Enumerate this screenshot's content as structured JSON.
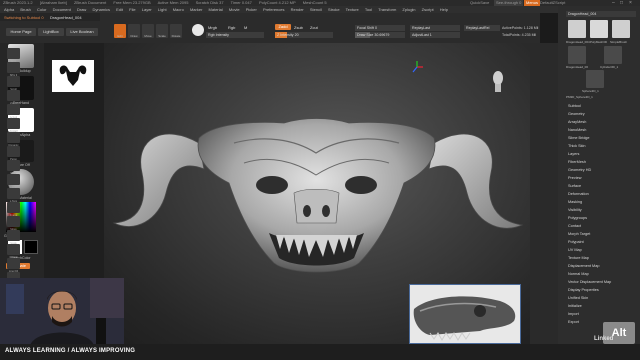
{
  "titlebar": {
    "app": "ZBrush 2023.1.2",
    "license": "[Abraham Ikeb]",
    "document": "ZBrush Document",
    "free_mem": "Free Mem 23.279GB",
    "active_mem": "Active Mem 2095",
    "scratch_disk": "Scratch Disk 37",
    "timer": "Timer 0.047",
    "polycount": "PolyCount 4.212 MP",
    "meshcount": "MeshCount 5",
    "quicksave": "QuickSave",
    "see_through": "See-through 0",
    "menus": "Menus",
    "default_script": "DefaultZScript"
  },
  "menubar": [
    "Alpha",
    "Brush",
    "Color",
    "Document",
    "Draw",
    "Dynamics",
    "Edit",
    "File",
    "Layer",
    "Light",
    "Macro",
    "Marker",
    "Material",
    "Movie",
    "Picker",
    "Preferences",
    "Render",
    "Stencil",
    "Stroke",
    "Texture",
    "Tool",
    "Transform",
    "Zplugin",
    "Zscript",
    "Help"
  ],
  "subtool_bar": {
    "switch_label": "Switching to Subtool 0",
    "tool_name": "DragonHead_004"
  },
  "nav": {
    "home": "Home Page",
    "lightbox": "LightBox",
    "live_boolean": "Live Boolean"
  },
  "shelf": {
    "tools": [
      "Edit",
      "Draw",
      "Move",
      "Scale",
      "Rotate"
    ],
    "mrgb": "Mrgb",
    "rgb": "Rgb",
    "m": "M",
    "rgb_intensity": "Rgb Intensity",
    "zadd": "Zadd",
    "zsub": "Zsub",
    "zcut": "Zcut",
    "z_intensity": "Z Intensity 20",
    "focal_shift": "Focal Shift 0",
    "draw_size": "Draw Size 30.69679",
    "replay_last": "ReplayLast",
    "replay_last_rel": "ReplayLastRel",
    "adjust_last": "AdjustLast 1",
    "active_points": "ActivePoints: 1.128 Mil",
    "total_points": "TotalPoints: 4.235 Mil"
  },
  "left_panel": {
    "clay_buildup": "ClayBuildup",
    "freehand": "FreeHand",
    "brush_alpha": "BrushAlpha",
    "texture_off": "Texture Off",
    "basic_material": "BasicMaterial",
    "gradient": "Gradient",
    "switch_color": "SwitchColor",
    "alternate": "Alternate"
  },
  "right_strip": [
    "BPR",
    "SPix 3",
    "Scroll",
    "Zoom",
    "Actual",
    "AAHalf",
    "Dynamic",
    "Persp",
    "Floor",
    "Local",
    "L.Sym",
    "Frame",
    "Move",
    "Scale",
    "Rotate",
    "Line Fill",
    "PolyF",
    "Transp",
    "Ghost",
    "Solo",
    "Xpose"
  ],
  "tool_panel": {
    "header": "DragonHead_004",
    "thumbs": [
      "DragonHead_004",
      "PolyMesh3D",
      "SimpleBrush",
      "DragonHead_00",
      "Cylinder3D_1",
      "Sphere3D_1",
      "PM3D_Sphere3D_1"
    ],
    "items": [
      "Subtool",
      "Geometry",
      "ArrayMesh",
      "NanoMesh",
      "Slime Bridge",
      "Thick Skin",
      "Layers",
      "FiberMesh",
      "Geometry HD",
      "Preview",
      "Surface",
      "Deformation",
      "Masking",
      "Visibility",
      "Polygroups",
      "Contact",
      "Morph Target",
      "Polypaint",
      "UV Map",
      "Texture Map",
      "Displacement Map",
      "Normal Map",
      "Vector Displacement Map",
      "Display Properties",
      "Unified Skin",
      "Initialize",
      "Import",
      "Export"
    ]
  },
  "overlays": {
    "alt_badge": "Alt",
    "watermark": "Linked",
    "footer_tag": "ALWAYS LEARNING  /  ALWAYS IMPROVING"
  },
  "colors": {
    "accent": "#e07a30",
    "panel": "#2d2d2d",
    "viewport": "#4a4a4a"
  }
}
